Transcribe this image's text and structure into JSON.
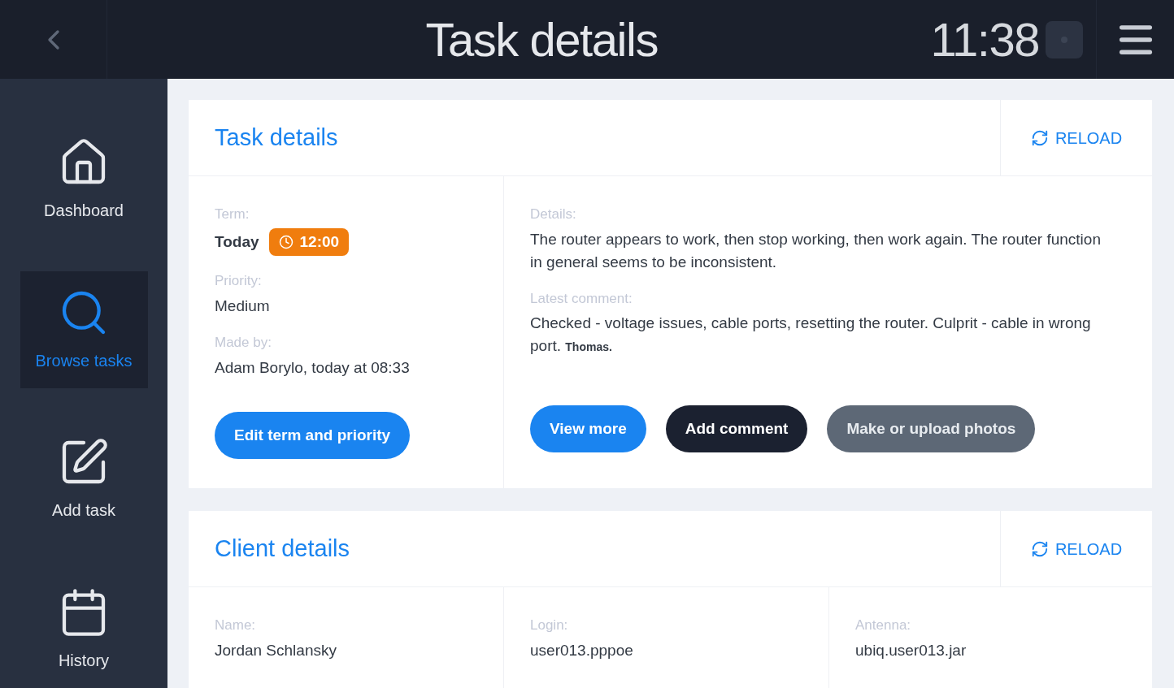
{
  "header": {
    "title": "Task details",
    "time": "11:38"
  },
  "sidebar": {
    "items": [
      {
        "kind": "home",
        "label": "Dashboard",
        "selected": false
      },
      {
        "kind": "search",
        "label": "Browse tasks",
        "selected": true
      },
      {
        "kind": "edit",
        "label": "Add task",
        "selected": false
      },
      {
        "kind": "calendar",
        "label": "History",
        "selected": false
      }
    ]
  },
  "task_card": {
    "title": "Task details",
    "reload": "RELOAD",
    "term": {
      "label": "Term:",
      "value": "Today",
      "badge": "12:00"
    },
    "priority": {
      "label": "Priority:",
      "value": "Medium"
    },
    "made_by": {
      "label": "Made by:",
      "value": "Adam Borylo, today at 08:33"
    },
    "details": {
      "label": "Details:",
      "value": "The router appears to work, then stop working, then work again. The router function in general seems to be inconsistent."
    },
    "latest_comment": {
      "label": "Latest comment:",
      "value": "Checked - voltage issues, cable ports, resetting the router. Culprit - cable in wrong port. **Thomas.**"
    },
    "buttons": [
      {
        "kind": "primary",
        "label": "Edit term and priority"
      },
      {
        "kind": "primary",
        "label": "View more"
      },
      {
        "kind": "dark",
        "label": "Add comment"
      },
      {
        "kind": "muted",
        "label": "Make or upload photos"
      }
    ]
  },
  "client_card": {
    "title": "Client details",
    "reload": "RELOAD",
    "fields": [
      {
        "label": "Name:",
        "value": "Jordan Schlansky"
      },
      {
        "label": "Login:",
        "value": "user013.pppoe"
      },
      {
        "label": "Antenna:",
        "value": "ubiq.user013.jar"
      }
    ]
  }
}
